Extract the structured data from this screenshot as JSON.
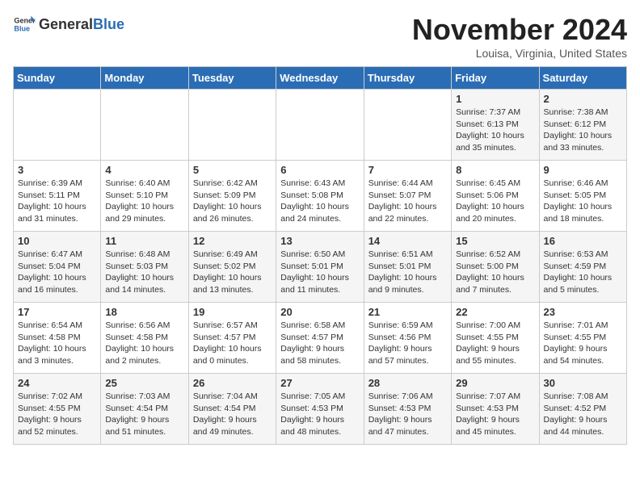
{
  "logo": {
    "general": "General",
    "blue": "Blue"
  },
  "header": {
    "month": "November 2024",
    "location": "Louisa, Virginia, United States"
  },
  "weekdays": [
    "Sunday",
    "Monday",
    "Tuesday",
    "Wednesday",
    "Thursday",
    "Friday",
    "Saturday"
  ],
  "weeks": [
    [
      {
        "day": "",
        "info": ""
      },
      {
        "day": "",
        "info": ""
      },
      {
        "day": "",
        "info": ""
      },
      {
        "day": "",
        "info": ""
      },
      {
        "day": "",
        "info": ""
      },
      {
        "day": "1",
        "info": "Sunrise: 7:37 AM\nSunset: 6:13 PM\nDaylight: 10 hours and 35 minutes."
      },
      {
        "day": "2",
        "info": "Sunrise: 7:38 AM\nSunset: 6:12 PM\nDaylight: 10 hours and 33 minutes."
      }
    ],
    [
      {
        "day": "3",
        "info": "Sunrise: 6:39 AM\nSunset: 5:11 PM\nDaylight: 10 hours and 31 minutes."
      },
      {
        "day": "4",
        "info": "Sunrise: 6:40 AM\nSunset: 5:10 PM\nDaylight: 10 hours and 29 minutes."
      },
      {
        "day": "5",
        "info": "Sunrise: 6:42 AM\nSunset: 5:09 PM\nDaylight: 10 hours and 26 minutes."
      },
      {
        "day": "6",
        "info": "Sunrise: 6:43 AM\nSunset: 5:08 PM\nDaylight: 10 hours and 24 minutes."
      },
      {
        "day": "7",
        "info": "Sunrise: 6:44 AM\nSunset: 5:07 PM\nDaylight: 10 hours and 22 minutes."
      },
      {
        "day": "8",
        "info": "Sunrise: 6:45 AM\nSunset: 5:06 PM\nDaylight: 10 hours and 20 minutes."
      },
      {
        "day": "9",
        "info": "Sunrise: 6:46 AM\nSunset: 5:05 PM\nDaylight: 10 hours and 18 minutes."
      }
    ],
    [
      {
        "day": "10",
        "info": "Sunrise: 6:47 AM\nSunset: 5:04 PM\nDaylight: 10 hours and 16 minutes."
      },
      {
        "day": "11",
        "info": "Sunrise: 6:48 AM\nSunset: 5:03 PM\nDaylight: 10 hours and 14 minutes."
      },
      {
        "day": "12",
        "info": "Sunrise: 6:49 AM\nSunset: 5:02 PM\nDaylight: 10 hours and 13 minutes."
      },
      {
        "day": "13",
        "info": "Sunrise: 6:50 AM\nSunset: 5:01 PM\nDaylight: 10 hours and 11 minutes."
      },
      {
        "day": "14",
        "info": "Sunrise: 6:51 AM\nSunset: 5:01 PM\nDaylight: 10 hours and 9 minutes."
      },
      {
        "day": "15",
        "info": "Sunrise: 6:52 AM\nSunset: 5:00 PM\nDaylight: 10 hours and 7 minutes."
      },
      {
        "day": "16",
        "info": "Sunrise: 6:53 AM\nSunset: 4:59 PM\nDaylight: 10 hours and 5 minutes."
      }
    ],
    [
      {
        "day": "17",
        "info": "Sunrise: 6:54 AM\nSunset: 4:58 PM\nDaylight: 10 hours and 3 minutes."
      },
      {
        "day": "18",
        "info": "Sunrise: 6:56 AM\nSunset: 4:58 PM\nDaylight: 10 hours and 2 minutes."
      },
      {
        "day": "19",
        "info": "Sunrise: 6:57 AM\nSunset: 4:57 PM\nDaylight: 10 hours and 0 minutes."
      },
      {
        "day": "20",
        "info": "Sunrise: 6:58 AM\nSunset: 4:57 PM\nDaylight: 9 hours and 58 minutes."
      },
      {
        "day": "21",
        "info": "Sunrise: 6:59 AM\nSunset: 4:56 PM\nDaylight: 9 hours and 57 minutes."
      },
      {
        "day": "22",
        "info": "Sunrise: 7:00 AM\nSunset: 4:55 PM\nDaylight: 9 hours and 55 minutes."
      },
      {
        "day": "23",
        "info": "Sunrise: 7:01 AM\nSunset: 4:55 PM\nDaylight: 9 hours and 54 minutes."
      }
    ],
    [
      {
        "day": "24",
        "info": "Sunrise: 7:02 AM\nSunset: 4:55 PM\nDaylight: 9 hours and 52 minutes."
      },
      {
        "day": "25",
        "info": "Sunrise: 7:03 AM\nSunset: 4:54 PM\nDaylight: 9 hours and 51 minutes."
      },
      {
        "day": "26",
        "info": "Sunrise: 7:04 AM\nSunset: 4:54 PM\nDaylight: 9 hours and 49 minutes."
      },
      {
        "day": "27",
        "info": "Sunrise: 7:05 AM\nSunset: 4:53 PM\nDaylight: 9 hours and 48 minutes."
      },
      {
        "day": "28",
        "info": "Sunrise: 7:06 AM\nSunset: 4:53 PM\nDaylight: 9 hours and 47 minutes."
      },
      {
        "day": "29",
        "info": "Sunrise: 7:07 AM\nSunset: 4:53 PM\nDaylight: 9 hours and 45 minutes."
      },
      {
        "day": "30",
        "info": "Sunrise: 7:08 AM\nSunset: 4:52 PM\nDaylight: 9 hours and 44 minutes."
      }
    ]
  ]
}
